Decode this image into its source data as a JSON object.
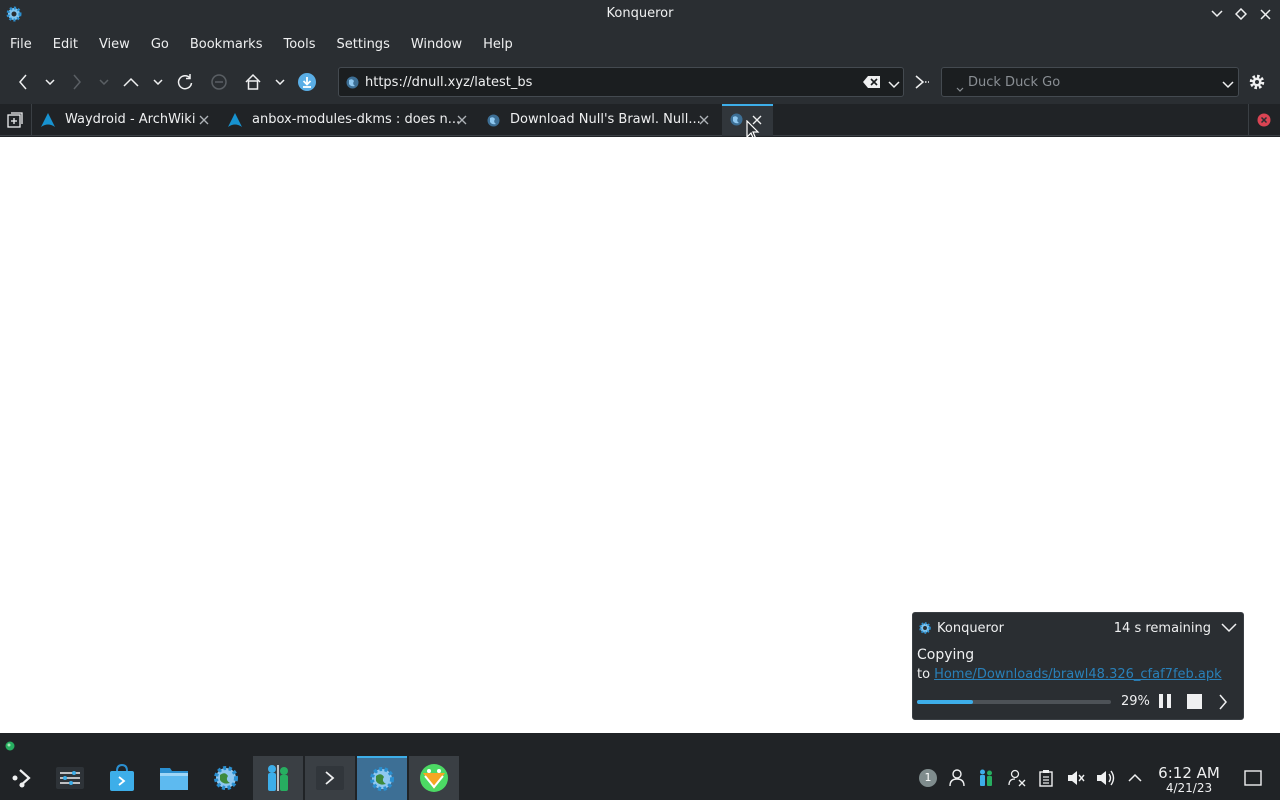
{
  "window": {
    "title": "Konqueror"
  },
  "menu": {
    "items": [
      "File",
      "Edit",
      "View",
      "Go",
      "Bookmarks",
      "Tools",
      "Settings",
      "Window",
      "Help"
    ]
  },
  "toolbar": {
    "url": "https://dnull.xyz/latest_bs",
    "search_engine": "Duck Duck Go"
  },
  "tabs": [
    {
      "label": "Waydroid - ArchWiki",
      "icon": "archlinux-icon"
    },
    {
      "label": "anbox-modules-dkms : does n...",
      "icon": "archlinux-icon"
    },
    {
      "label": "Download Null's Brawl. Null...",
      "icon": "globe-icon"
    },
    {
      "label": "",
      "icon": "globe-icon",
      "active": true
    }
  ],
  "notification": {
    "app": "Konqueror",
    "remaining": "14 s remaining",
    "title": "Copying",
    "to_prefix": "to",
    "link": "Home/Downloads/brawl48.326_cfaf7feb.apk",
    "progress_fraction": 0.29,
    "percent_text": "29%"
  },
  "taskbar": {
    "tray_badge": "1",
    "time": "6:12 AM",
    "date": "4/21/23"
  },
  "colors": {
    "accent": "#3daee9",
    "bg": "#2a2e32",
    "link": "#2980b9"
  }
}
